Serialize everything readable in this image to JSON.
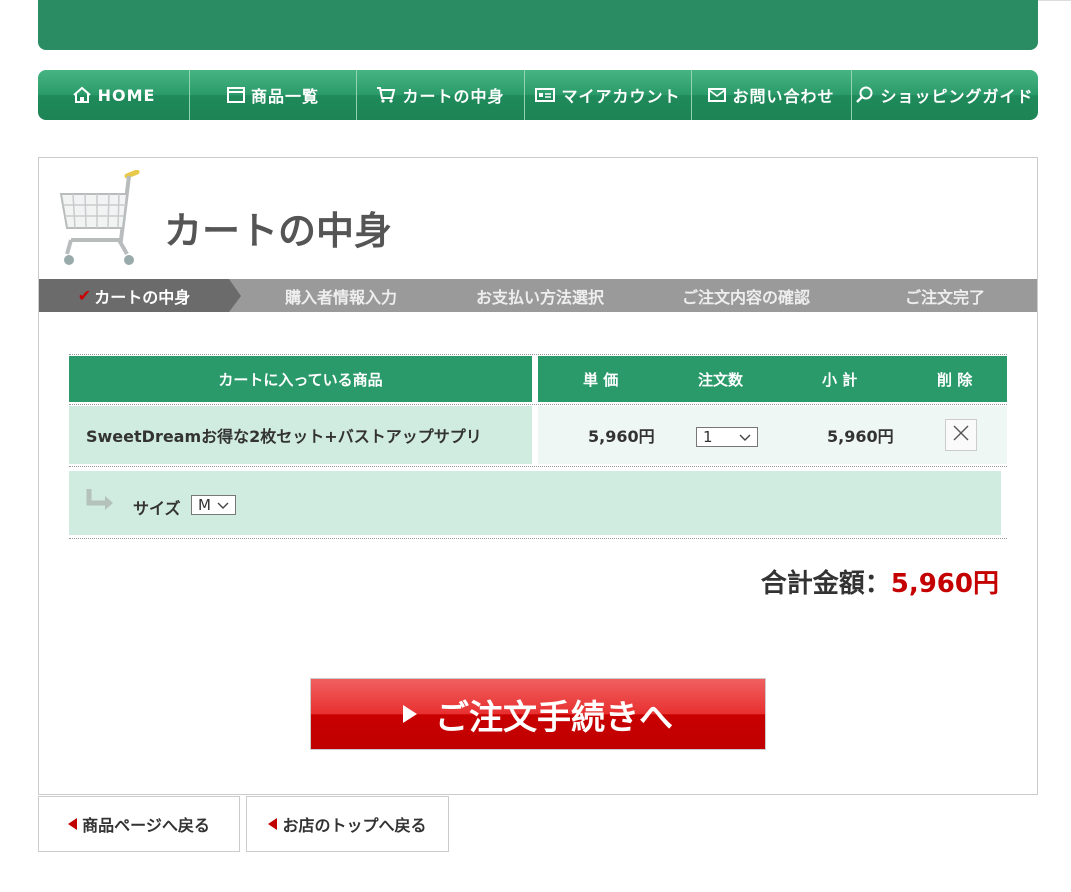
{
  "nav": {
    "items": [
      {
        "label": "HOME",
        "icon": "home-icon"
      },
      {
        "label": "商品一覧",
        "icon": "list-icon"
      },
      {
        "label": "カートの中身",
        "icon": "cart-icon"
      },
      {
        "label": "マイアカウント",
        "icon": "account-card-icon"
      },
      {
        "label": "お問い合わせ",
        "icon": "mail-icon"
      },
      {
        "label": "ショッピングガイド",
        "icon": "search-icon"
      }
    ]
  },
  "page": {
    "title": "カートの中身"
  },
  "steps": [
    "カートの中身",
    "購入者情報入力",
    "お支払い方法選択",
    "ご注文内容の確認",
    "ご注文完了"
  ],
  "table": {
    "headers": {
      "product": "カートに入っている商品",
      "price": "単 価",
      "qty": "注文数",
      "subtotal": "小 計",
      "delete": "削 除"
    },
    "item": {
      "name": "SweetDreamお得な2枚セット+バストアップサプリ",
      "price": "5,960円",
      "qty": "1",
      "subtotal": "5,960円",
      "size_label": "サイズ",
      "size_value": "M"
    }
  },
  "total": {
    "label": "合計金額：",
    "amount": "5,960円"
  },
  "order_button": "ご注文手続きへ",
  "back_links": {
    "product_page": "商品ページへ戻る",
    "shop_top": "お店のトップへ戻る"
  },
  "colors": {
    "brand_green": "#2a8c63",
    "accent_red": "#c40000"
  }
}
